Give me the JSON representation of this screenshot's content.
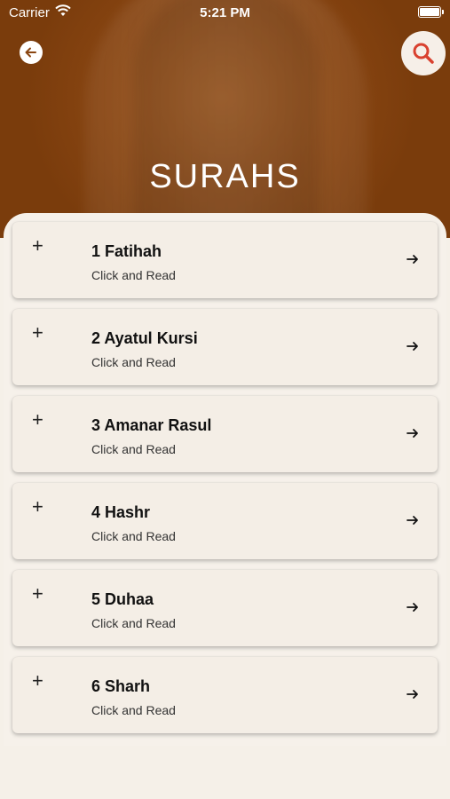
{
  "status": {
    "carrier": "Carrier",
    "time": "5:21 PM"
  },
  "header": {
    "title": "SURAHS"
  },
  "surahs": [
    {
      "title": "1 Fatihah",
      "subtitle": "Click and Read"
    },
    {
      "title": "2 Ayatul Kursi",
      "subtitle": "Click and Read"
    },
    {
      "title": "3 Amanar Rasul",
      "subtitle": "Click and Read"
    },
    {
      "title": "4 Hashr",
      "subtitle": "Click and Read"
    },
    {
      "title": "5 Duhaa",
      "subtitle": "Click and Read"
    },
    {
      "title": "6 Sharh",
      "subtitle": "Click and Read"
    }
  ],
  "icons": {
    "back": "arrow-left-icon",
    "search": "search-icon",
    "expand": "plus-icon",
    "open": "arrow-right-icon"
  },
  "colors": {
    "header": "#8a4612",
    "accent": "#d9412f",
    "card": "#f4eee6"
  }
}
